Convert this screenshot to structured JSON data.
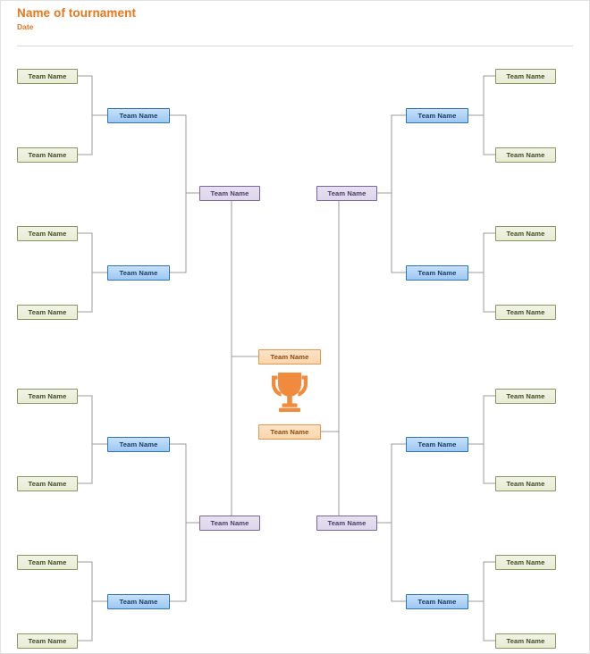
{
  "header": {
    "title": "Name of tournament",
    "date": "Date",
    "accent_color": "#E8761B"
  },
  "bracket": {
    "team_label": "Team Name",
    "colors": {
      "round1_fill": "#eaeed6",
      "round1_border": "#889461",
      "round2_fill": "#a9d2f7",
      "round2_border": "#2e75b6",
      "round3_fill": "#e0d8ee",
      "round3_border": "#7a629c",
      "round4_fill": "#fbd8b2",
      "round4_border": "#e8944a",
      "connector": "#9b9b9b"
    },
    "left": {
      "round1": [
        {
          "label": "Team Name"
        },
        {
          "label": "Team Name"
        },
        {
          "label": "Team Name"
        },
        {
          "label": "Team Name"
        },
        {
          "label": "Team Name"
        },
        {
          "label": "Team Name"
        },
        {
          "label": "Team Name"
        },
        {
          "label": "Team Name"
        }
      ],
      "round2": [
        {
          "label": "Team Name"
        },
        {
          "label": "Team Name"
        },
        {
          "label": "Team Name"
        },
        {
          "label": "Team Name"
        }
      ],
      "round3": [
        {
          "label": "Team Name"
        },
        {
          "label": "Team Name"
        }
      ]
    },
    "right": {
      "round1": [
        {
          "label": "Team Name"
        },
        {
          "label": "Team Name"
        },
        {
          "label": "Team Name"
        },
        {
          "label": "Team Name"
        },
        {
          "label": "Team Name"
        },
        {
          "label": "Team Name"
        },
        {
          "label": "Team Name"
        },
        {
          "label": "Team Name"
        }
      ],
      "round2": [
        {
          "label": "Team Name"
        },
        {
          "label": "Team Name"
        },
        {
          "label": "Team Name"
        },
        {
          "label": "Team Name"
        }
      ],
      "round3": [
        {
          "label": "Team Name"
        },
        {
          "label": "Team Name"
        }
      ]
    },
    "final": [
      {
        "label": "Team Name"
      },
      {
        "label": "Team Name"
      }
    ],
    "trophy": {
      "icon": "trophy-icon",
      "color": "#F08A3C"
    }
  }
}
